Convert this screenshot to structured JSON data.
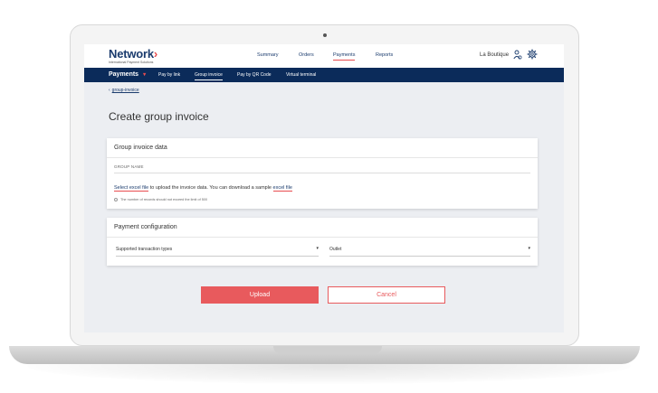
{
  "brand": {
    "name": "Network",
    "tagline": "International Payment Solutions"
  },
  "top_nav": [
    {
      "label": "Summary"
    },
    {
      "label": "Orders"
    },
    {
      "label": "Payments"
    },
    {
      "label": "Reports"
    }
  ],
  "active_top_nav": "Payments",
  "merchant": {
    "name": "La Boutique"
  },
  "sub_nav": {
    "main_label": "Payments",
    "items": [
      {
        "label": "Pay by link"
      },
      {
        "label": "Group invoice"
      },
      {
        "label": "Pay by QR Code"
      },
      {
        "label": "Virtual terminal"
      }
    ],
    "active": "Group invoice"
  },
  "breadcrumb": {
    "label": "group-invoice"
  },
  "page_title": "Create group invoice",
  "invoice_card": {
    "title": "Group invoice data",
    "group_name_label": "GROUP NAME",
    "upload_link": "Select excel file",
    "upload_text": " to upload the invoice data. You can download a sample ",
    "sample_link": "excel file",
    "note": "The number of records should not exceed the limit of 500"
  },
  "payment_card": {
    "title": "Payment configuration",
    "transaction_types_label": "Supported transaction types",
    "outlet_label": "Outlet"
  },
  "buttons": {
    "upload": "Upload",
    "cancel": "Cancel"
  },
  "colors": {
    "brand_navy": "#0b2b5a",
    "accent_red": "#e85a5d"
  }
}
